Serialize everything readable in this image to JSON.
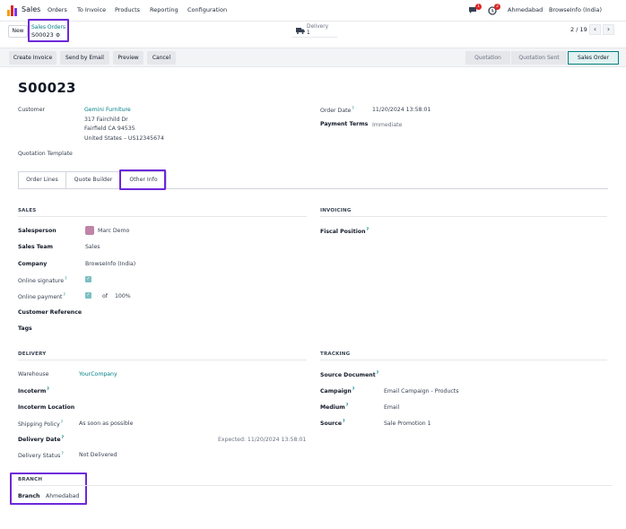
{
  "topbar": {
    "app": "Sales",
    "menu": [
      "Orders",
      "To Invoice",
      "Products",
      "Reporting",
      "Configuration"
    ],
    "chat_count": "1",
    "activity_count": "2",
    "branch": "Ahmedabad",
    "company": "BrowseInfo (India)"
  },
  "control": {
    "new_label": "New",
    "breadcrumb_link": "Sales Orders",
    "record_name": "S00023",
    "delivery_label": "Delivery",
    "delivery_count": "1",
    "pager": "2 / 19"
  },
  "actions": [
    "Create Invoice",
    "Send by Email",
    "Preview",
    "Cancel"
  ],
  "stages": [
    "Quotation",
    "Quotation Sent",
    "Sales Order"
  ],
  "form": {
    "title": "S00023",
    "customer_label": "Customer",
    "customer_name": "Gemini Furniture",
    "customer_address": [
      "317 Fairchild Dr",
      "Fairfield CA 94535",
      "United States – US12345674"
    ],
    "order_date_label": "Order Date",
    "order_date": "11/20/2024 13:58:01",
    "payment_terms_label": "Payment Terms",
    "payment_terms": "Immediate",
    "quotation_template_label": "Quotation Template",
    "tabs": [
      "Order Lines",
      "Quote Builder",
      "Other Info"
    ],
    "sales": {
      "heading": "SALES",
      "salesperson_label": "Salesperson",
      "salesperson": "Marc Demo",
      "sales_team_label": "Sales Team",
      "sales_team": "Sales",
      "company_label": "Company",
      "company": "BrowseInfo (India)",
      "online_signature_label": "Online signature",
      "online_payment_label": "Online payment",
      "online_payment_of": "of",
      "online_payment_pct": "100%",
      "customer_reference_label": "Customer Reference",
      "tags_label": "Tags"
    },
    "invoicing": {
      "heading": "INVOICING",
      "fiscal_position_label": "Fiscal Position"
    },
    "delivery": {
      "heading": "DELIVERY",
      "warehouse_label": "Warehouse",
      "warehouse": "YourCompany",
      "incoterm_label": "Incoterm",
      "incoterm_location_label": "Incoterm Location",
      "shipping_policy_label": "Shipping Policy",
      "shipping_policy": "As soon as possible",
      "delivery_date_label": "Delivery Date",
      "delivery_date_expected": "Expected: 11/20/2024 13:58:01",
      "delivery_status_label": "Delivery Status",
      "delivery_status": "Not Delivered"
    },
    "tracking": {
      "heading": "TRACKING",
      "source_document_label": "Source Document",
      "campaign_label": "Campaign",
      "campaign": "Email Campaign - Products",
      "medium_label": "Medium",
      "medium": "Email",
      "source_label": "Source",
      "source": "Sale Promotion 1"
    },
    "branch": {
      "heading": "BRANCH",
      "branch_label": "Branch",
      "branch": "Ahmedabad"
    }
  },
  "colors": {
    "accent": "#017e84",
    "highlight": "#6d28d9",
    "badge": "#dc2626"
  }
}
